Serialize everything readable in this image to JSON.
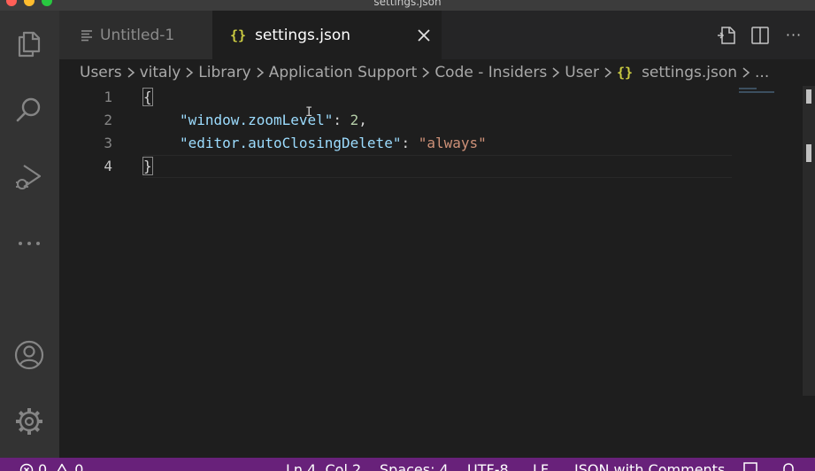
{
  "window": {
    "title": "settings.json"
  },
  "tabs": [
    {
      "label": "Untitled-1",
      "active": false
    },
    {
      "label": "settings.json",
      "active": true
    }
  ],
  "breadcrumb": {
    "segments": [
      "Users",
      "vitaly",
      "Library",
      "Application Support",
      "Code - Insiders",
      "User"
    ],
    "file": "settings.json",
    "more": "..."
  },
  "editor": {
    "line_numbers": [
      "1",
      "2",
      "3",
      "4"
    ],
    "lines": {
      "l1_brace": "{",
      "l2_key": "\"window.zoomLevel\"",
      "l2_colon": ": ",
      "l2_value": "2",
      "l2_comma": ",",
      "l3_key": "\"editor.autoClosingDelete\"",
      "l3_colon": ": ",
      "l3_value": "\"always\"",
      "l4_brace": "}"
    },
    "cursor_glyph": "I"
  },
  "tab_actions": {
    "more": "···"
  },
  "statusbar": {
    "errors": "0",
    "warnings": "0",
    "position": "Ln 4, Col 2",
    "spaces": "Spaces: 4",
    "encoding": "UTF-8",
    "eol": "LF",
    "language": "JSON with Comments"
  },
  "colors": {
    "statusbar": "#68217a",
    "activitybar": "#333333",
    "editor_bg": "#1e1e1e",
    "json_key": "#9cdcfe",
    "json_string": "#ce9178",
    "json_number": "#b5cea8",
    "json_icon": "#cbcb41"
  },
  "icons": {
    "activity": [
      "files-icon",
      "search-icon",
      "run-debug-icon",
      "more-icon",
      "account-icon",
      "gear-icon"
    ],
    "tab_actions": [
      "open-settings-json-icon",
      "split-editor-icon",
      "more-actions-icon"
    ]
  }
}
